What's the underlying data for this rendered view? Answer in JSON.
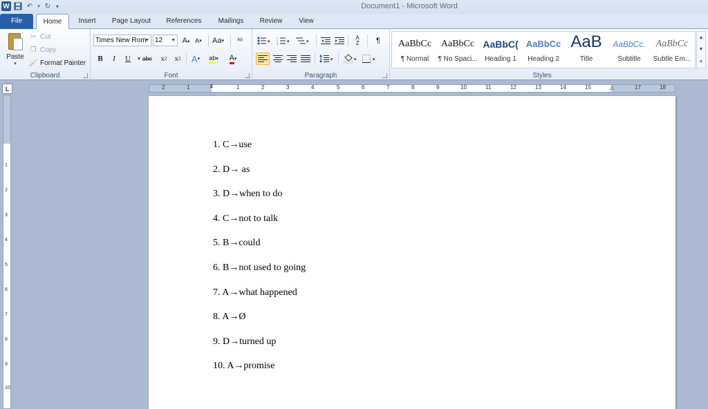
{
  "window": {
    "title": "Document1 - Microsoft Word"
  },
  "tabs": [
    "File",
    "Home",
    "Insert",
    "Page Layout",
    "References",
    "Mailings",
    "Review",
    "View"
  ],
  "clipboard": {
    "paste": "Paste",
    "cut": "Cut",
    "copy": "Copy",
    "format_painter": "Format Painter",
    "label": "Clipboard"
  },
  "font": {
    "name": "Times New Rom",
    "size": "12",
    "label": "Font",
    "change_case": "Aa",
    "grow": "A",
    "shrink": "A",
    "clear": "A",
    "bold": "B",
    "italic": "I",
    "underline": "U",
    "strike": "abc",
    "sub": "x",
    "sup": "x",
    "effects": "A",
    "highlight": "ab",
    "color": "A"
  },
  "paragraph": {
    "label": "Paragraph",
    "pilcrow": "¶",
    "sort": "A Z"
  },
  "styles": {
    "label": "Styles",
    "items": [
      {
        "sample": "AaBbCc",
        "name": "¶ Normal"
      },
      {
        "sample": "AaBbCc",
        "name": "¶ No Spaci..."
      },
      {
        "sample": "AaBbC(",
        "name": "Heading 1"
      },
      {
        "sample": "AaBbCc",
        "name": "Heading 2"
      },
      {
        "sample": "AaB",
        "name": "Title"
      },
      {
        "sample": "AaBbCc.",
        "name": "Subtitle"
      },
      {
        "sample": "AaBbCc",
        "name": "Subtle Em..."
      }
    ]
  },
  "ruler": {
    "tab_selector": "L",
    "numbers": [
      "2",
      "1",
      "1",
      "2",
      "3",
      "4",
      "5",
      "6",
      "7",
      "8",
      "9",
      "10",
      "11",
      "12",
      "13",
      "14",
      "15",
      "16",
      "17",
      "18"
    ]
  },
  "document": {
    "lines": [
      "1. C→use",
      "2. D→ as",
      "3. D→when to do",
      "4. C→not to talk",
      "5. B→could",
      "6. B→not used to going",
      "7. A→what happened",
      "8. A→Ø",
      "9. D→turned up",
      "10. A→promise"
    ]
  },
  "colors": {
    "file_tab": "#2a5fa8",
    "ribbon": "#fbfcfe",
    "workspace": "#abbad0",
    "selected_style": "#fde9a8"
  }
}
